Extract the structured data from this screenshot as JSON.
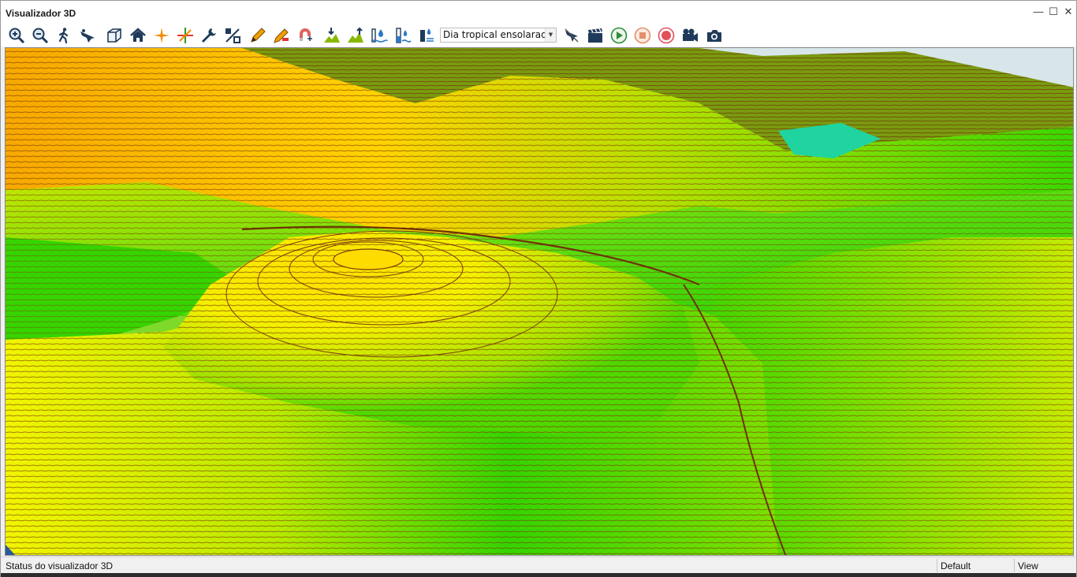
{
  "window": {
    "title": "Visualizador 3D",
    "minimize_glyph": "—",
    "maximize_glyph": "☐",
    "close_glyph": "✕"
  },
  "toolbar": {
    "buttons": [
      "zoom-in-icon",
      "zoom-out-icon",
      "walk-icon",
      "fly-icon",
      "cube-view-icon",
      "home-icon",
      "orange-crosshair-icon",
      "axis-crosshair-icon",
      "wrench-icon",
      "percent-icon",
      "pencil-icon",
      "measure-pencil-icon",
      "magnet-icon",
      "terrain-down-icon",
      "terrain-up-icon",
      "water-level-icon",
      "water-gauge-icon",
      "water-tower-icon"
    ],
    "environment_select": {
      "value": "Dia tropical ensolarado"
    },
    "right_buttons": [
      "no-fly-icon",
      "clapperboard-icon",
      "play-icon",
      "stop-icon",
      "record-icon",
      "camera-video-icon",
      "camera-photo-icon"
    ]
  },
  "colors": {
    "terrain_high": "#ffe400",
    "terrain_mid": "#8ee51c",
    "terrain_low": "#22d400",
    "peak_orange": "#f2a800",
    "contour": "#7a3a0a"
  },
  "statusbar": {
    "status": "Status do visualizador 3D",
    "profile": "Default",
    "mode": "View"
  }
}
